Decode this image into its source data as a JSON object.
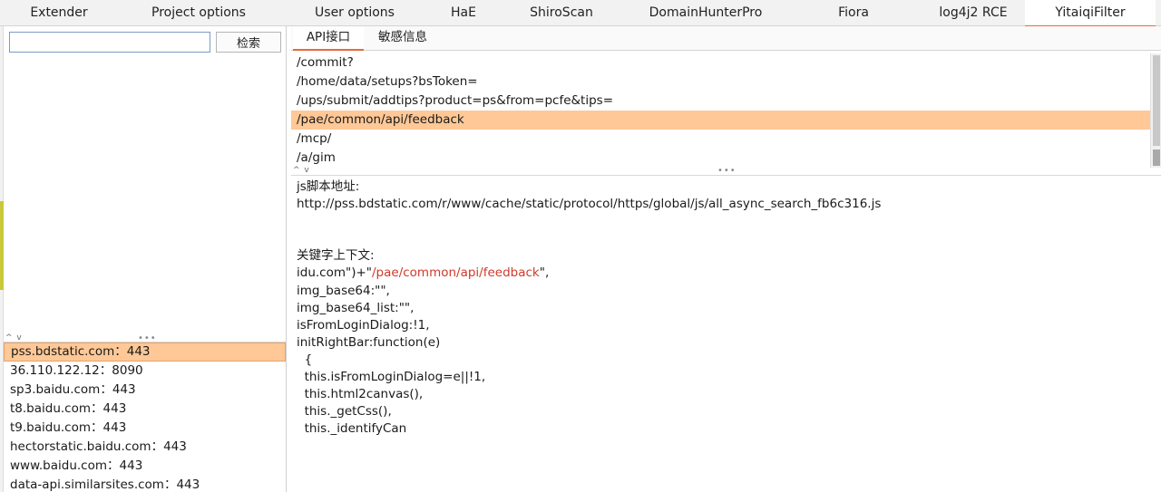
{
  "top_tabs": [
    {
      "label": "Extender"
    },
    {
      "label": "Project options"
    },
    {
      "label": "User options"
    },
    {
      "label": "HaE"
    },
    {
      "label": "ShiroScan"
    },
    {
      "label": "DomainHunterPro"
    },
    {
      "label": "Fiora"
    },
    {
      "label": "log4j2 RCE"
    },
    {
      "label": "YitaiqiFilter",
      "active": true
    }
  ],
  "search": {
    "value": "",
    "button_label": "检索"
  },
  "hosts": [
    "pss.bdstatic.com：443",
    "36.110.122.12：8090",
    "sp3.baidu.com：443",
    "t8.baidu.com：443",
    "t9.baidu.com：443",
    "hectorstatic.baidu.com：443",
    "www.baidu.com：443",
    "data-api.similarsites.com：443"
  ],
  "selected_host_index": 0,
  "sub_tabs": [
    {
      "label": "API接口",
      "active": true
    },
    {
      "label": "敏感信息"
    }
  ],
  "api_list": [
    "/commit?",
    "/home/data/setups?bsToken=",
    "/ups/submit/addtips?product=ps&from=pcfe&tips=",
    "/pae/common/api/feedback",
    "/mcp/",
    "/a/gim"
  ],
  "selected_api_index": 3,
  "detail": {
    "script_label": "js脚本地址:",
    "script_url": "http://pss.bdstatic.com/r/www/cache/static/protocol/https/global/js/all_async_search_fb6c316.js",
    "context_label": "关键字上下文:",
    "context_prefix": "idu.com\")+\"",
    "context_keyword": "/pae/common/api/feedback",
    "context_suffix": "\",",
    "context_lines": [
      "img_base64:\"\",",
      "img_base64_list:\"\",",
      "isFromLoginDialog:!1,",
      "initRightBar:function(e)",
      "  {",
      "  this.isFromLoginDialog=e||!1,",
      "  this.html2canvas(),",
      "  this._getCss(),",
      "  this._identifyCan"
    ]
  },
  "colors": {
    "selection": "#ffc896",
    "active_tab_accent": "#e8693d",
    "keyword": "#d03a2b"
  }
}
